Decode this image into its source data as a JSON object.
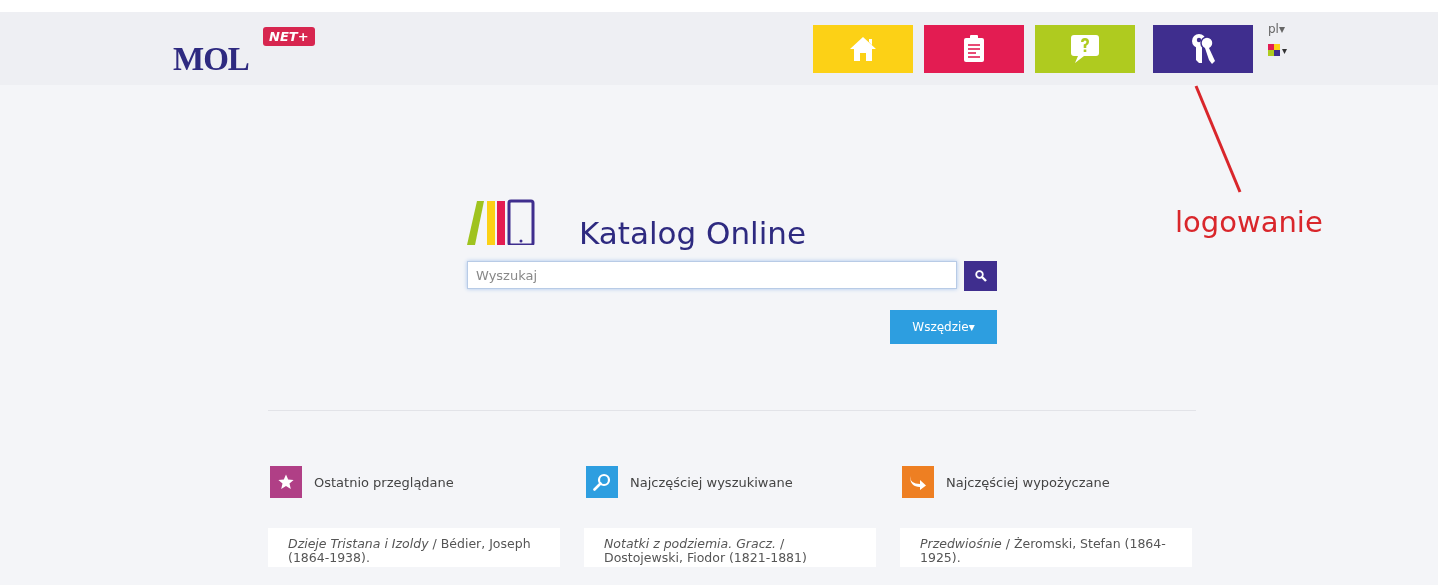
{
  "header": {
    "logo": "MOL",
    "logo_badge": "NET+",
    "nav": [
      {
        "kind": "home",
        "color": "#fcd116"
      },
      {
        "kind": "clipboard",
        "color": "#e31c52"
      },
      {
        "kind": "help",
        "color": "#afcb1f"
      },
      {
        "kind": "keys",
        "color": "#3f2e8e"
      }
    ],
    "language": "pl▾",
    "theme_caret": "▾"
  },
  "catalog": {
    "title": "Katalog Online",
    "search": {
      "placeholder": "Wyszukaj"
    },
    "scope_button": "Wszędzie▾"
  },
  "sections": [
    {
      "kind": "star",
      "color": "#b03f86",
      "title": "Ostatnio przeglądane",
      "item": "*Dzieje Tristana i Izoldy* / Bédier, Joseph (1864-1938)."
    },
    {
      "kind": "search",
      "color": "#2d9ee0",
      "title": "Najczęściej wyszukiwane",
      "item": "*Notatki z podziemia. Gracz.* / Dostojewski, Fiodor (1821-1881)"
    },
    {
      "kind": "share",
      "color": "#ee7f22",
      "title": "Najczęściej wypożyczane",
      "item": "*Przedwiośnie* / Żeromski, Stefan (1864-1925)."
    }
  ],
  "annotation": {
    "label": "logowanie"
  }
}
